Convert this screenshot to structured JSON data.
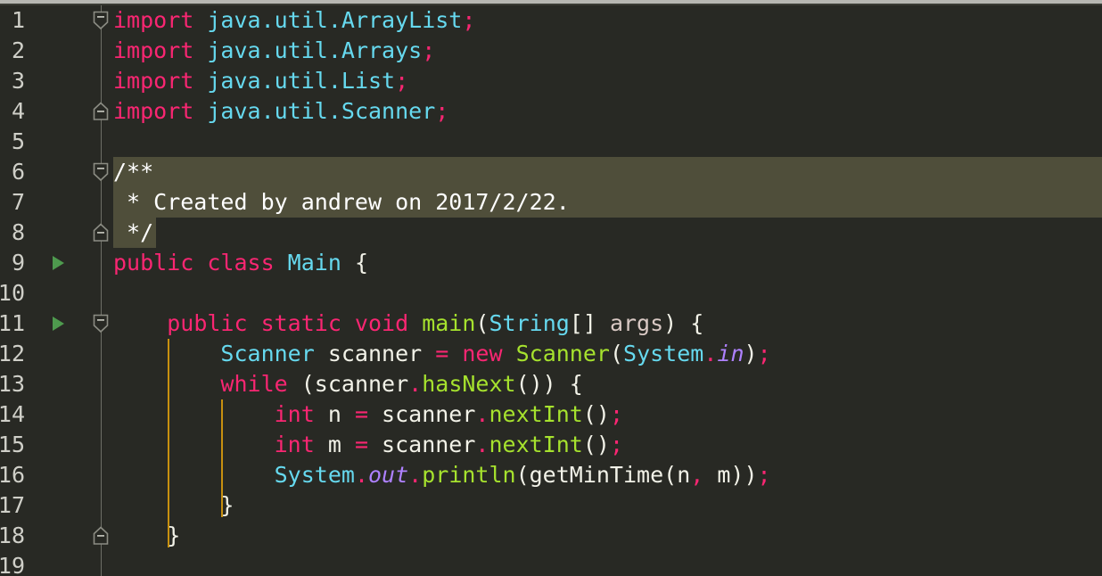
{
  "editor": {
    "language": "java",
    "colors": {
      "background": "#282924",
      "gutter_background": "#282924",
      "line_number": "#cfcfc8",
      "selection_highlight": "#4f4e3a",
      "indent_guide": "#c8900f",
      "fold_rail": "#6e6f66",
      "run_marker": "#4e9a4e",
      "keyword": "#f92672",
      "type": "#66d9ef",
      "function": "#a6e22e",
      "text": "#f2f2e8",
      "parameter": "#d9c9c4",
      "static_field": "#ae81ff",
      "comment": "#ffffff"
    },
    "first_visible_line": 1,
    "last_visible_line": 19,
    "line_numbers": [
      1,
      2,
      3,
      4,
      5,
      6,
      7,
      8,
      9,
      10,
      11,
      12,
      13,
      14,
      15,
      16,
      17,
      18,
      19
    ],
    "run_marker_lines": [
      9,
      11
    ],
    "fold_markers": [
      {
        "line": 1,
        "kind": "collapse-start"
      },
      {
        "line": 4,
        "kind": "collapse-end"
      },
      {
        "line": 6,
        "kind": "collapse-start"
      },
      {
        "line": 8,
        "kind": "collapse-end"
      },
      {
        "line": 11,
        "kind": "collapse-start"
      },
      {
        "line": 18,
        "kind": "collapse-end"
      }
    ],
    "highlighted_lines": [
      6,
      7,
      8
    ],
    "lines": [
      {
        "n": 1,
        "text": "import java.util.ArrayList;",
        "tokens": [
          {
            "t": "import",
            "c": "kw"
          },
          {
            "t": " ",
            "c": "txt"
          },
          {
            "t": "java.util.ArrayList",
            "c": "typ"
          },
          {
            "t": ";",
            "c": "kw"
          }
        ]
      },
      {
        "n": 2,
        "text": "import java.util.Arrays;",
        "tokens": [
          {
            "t": "import",
            "c": "kw"
          },
          {
            "t": " ",
            "c": "txt"
          },
          {
            "t": "java.util.Arrays",
            "c": "typ"
          },
          {
            "t": ";",
            "c": "kw"
          }
        ]
      },
      {
        "n": 3,
        "text": "import java.util.List;",
        "tokens": [
          {
            "t": "import",
            "c": "kw"
          },
          {
            "t": " ",
            "c": "txt"
          },
          {
            "t": "java.util.List",
            "c": "typ"
          },
          {
            "t": ";",
            "c": "kw"
          }
        ]
      },
      {
        "n": 4,
        "text": "import java.util.Scanner;",
        "tokens": [
          {
            "t": "import",
            "c": "kw"
          },
          {
            "t": " ",
            "c": "txt"
          },
          {
            "t": "java.util.Scanner",
            "c": "typ"
          },
          {
            "t": ";",
            "c": "kw"
          }
        ]
      },
      {
        "n": 5,
        "text": "",
        "tokens": []
      },
      {
        "n": 6,
        "text": "/**",
        "tokens": [
          {
            "t": "/**",
            "c": "cmt"
          }
        ]
      },
      {
        "n": 7,
        "text": " * Created by andrew on 2017/2/22.",
        "tokens": [
          {
            "t": " * Created by andrew on 2017/2/22.",
            "c": "cmt"
          }
        ]
      },
      {
        "n": 8,
        "text": " */",
        "tokens": [
          {
            "t": " */",
            "c": "cmt"
          }
        ]
      },
      {
        "n": 9,
        "text": "public class Main {",
        "tokens": [
          {
            "t": "public class ",
            "c": "kw"
          },
          {
            "t": "Main",
            "c": "typ"
          },
          {
            "t": " {",
            "c": "pun"
          }
        ]
      },
      {
        "n": 10,
        "text": "",
        "tokens": []
      },
      {
        "n": 11,
        "text": "    public static void main(String[] args) {",
        "tokens": [
          {
            "t": "    ",
            "c": "txt"
          },
          {
            "t": "public static void ",
            "c": "kw"
          },
          {
            "t": "main",
            "c": "fn"
          },
          {
            "t": "(",
            "c": "pun"
          },
          {
            "t": "String",
            "c": "typ"
          },
          {
            "t": "[] ",
            "c": "pun"
          },
          {
            "t": "args",
            "c": "prm"
          },
          {
            "t": ") {",
            "c": "pun"
          }
        ]
      },
      {
        "n": 12,
        "text": "        Scanner scanner = new Scanner(System.in);",
        "tokens": [
          {
            "t": "        ",
            "c": "txt"
          },
          {
            "t": "Scanner",
            "c": "typ"
          },
          {
            "t": " scanner ",
            "c": "txt"
          },
          {
            "t": "=",
            "c": "op"
          },
          {
            "t": " ",
            "c": "txt"
          },
          {
            "t": "new",
            "c": "kw"
          },
          {
            "t": " ",
            "c": "txt"
          },
          {
            "t": "Scanner",
            "c": "fn"
          },
          {
            "t": "(",
            "c": "pun"
          },
          {
            "t": "System",
            "c": "typ"
          },
          {
            "t": ".",
            "c": "op"
          },
          {
            "t": "in",
            "c": "fld"
          },
          {
            "t": ")",
            "c": "pun"
          },
          {
            "t": ";",
            "c": "op"
          }
        ]
      },
      {
        "n": 13,
        "text": "        while (scanner.hasNext()) {",
        "tokens": [
          {
            "t": "        ",
            "c": "txt"
          },
          {
            "t": "while",
            "c": "kw"
          },
          {
            "t": " (",
            "c": "pun"
          },
          {
            "t": "scanner",
            "c": "txt"
          },
          {
            "t": ".",
            "c": "op"
          },
          {
            "t": "hasNext",
            "c": "fn"
          },
          {
            "t": "()) {",
            "c": "pun"
          }
        ]
      },
      {
        "n": 14,
        "text": "            int n = scanner.nextInt();",
        "tokens": [
          {
            "t": "            ",
            "c": "txt"
          },
          {
            "t": "int",
            "c": "kw"
          },
          {
            "t": " n ",
            "c": "txt"
          },
          {
            "t": "=",
            "c": "op"
          },
          {
            "t": " scanner",
            "c": "txt"
          },
          {
            "t": ".",
            "c": "op"
          },
          {
            "t": "nextInt",
            "c": "fn"
          },
          {
            "t": "()",
            "c": "pun"
          },
          {
            "t": ";",
            "c": "op"
          }
        ]
      },
      {
        "n": 15,
        "text": "            int m = scanner.nextInt();",
        "tokens": [
          {
            "t": "            ",
            "c": "txt"
          },
          {
            "t": "int",
            "c": "kw"
          },
          {
            "t": " m ",
            "c": "txt"
          },
          {
            "t": "=",
            "c": "op"
          },
          {
            "t": " scanner",
            "c": "txt"
          },
          {
            "t": ".",
            "c": "op"
          },
          {
            "t": "nextInt",
            "c": "fn"
          },
          {
            "t": "()",
            "c": "pun"
          },
          {
            "t": ";",
            "c": "op"
          }
        ]
      },
      {
        "n": 16,
        "text": "            System.out.println(getMinTime(n, m));",
        "tokens": [
          {
            "t": "            ",
            "c": "txt"
          },
          {
            "t": "System",
            "c": "typ"
          },
          {
            "t": ".",
            "c": "op"
          },
          {
            "t": "out",
            "c": "fld"
          },
          {
            "t": ".",
            "c": "op"
          },
          {
            "t": "println",
            "c": "fn"
          },
          {
            "t": "(getMinTime(n",
            "c": "pun"
          },
          {
            "t": ",",
            "c": "op"
          },
          {
            "t": " m))",
            "c": "pun"
          },
          {
            "t": ";",
            "c": "op"
          }
        ]
      },
      {
        "n": 17,
        "text": "        }",
        "tokens": [
          {
            "t": "        }",
            "c": "pun"
          }
        ]
      },
      {
        "n": 18,
        "text": "    }",
        "tokens": [
          {
            "t": "    }",
            "c": "pun"
          }
        ]
      },
      {
        "n": 19,
        "text": "",
        "tokens": []
      }
    ],
    "indent_guides": [
      {
        "from_line": 11,
        "to_line": 18,
        "indent_col": 4
      },
      {
        "from_line": 13,
        "to_line": 17,
        "indent_col": 8
      }
    ]
  }
}
